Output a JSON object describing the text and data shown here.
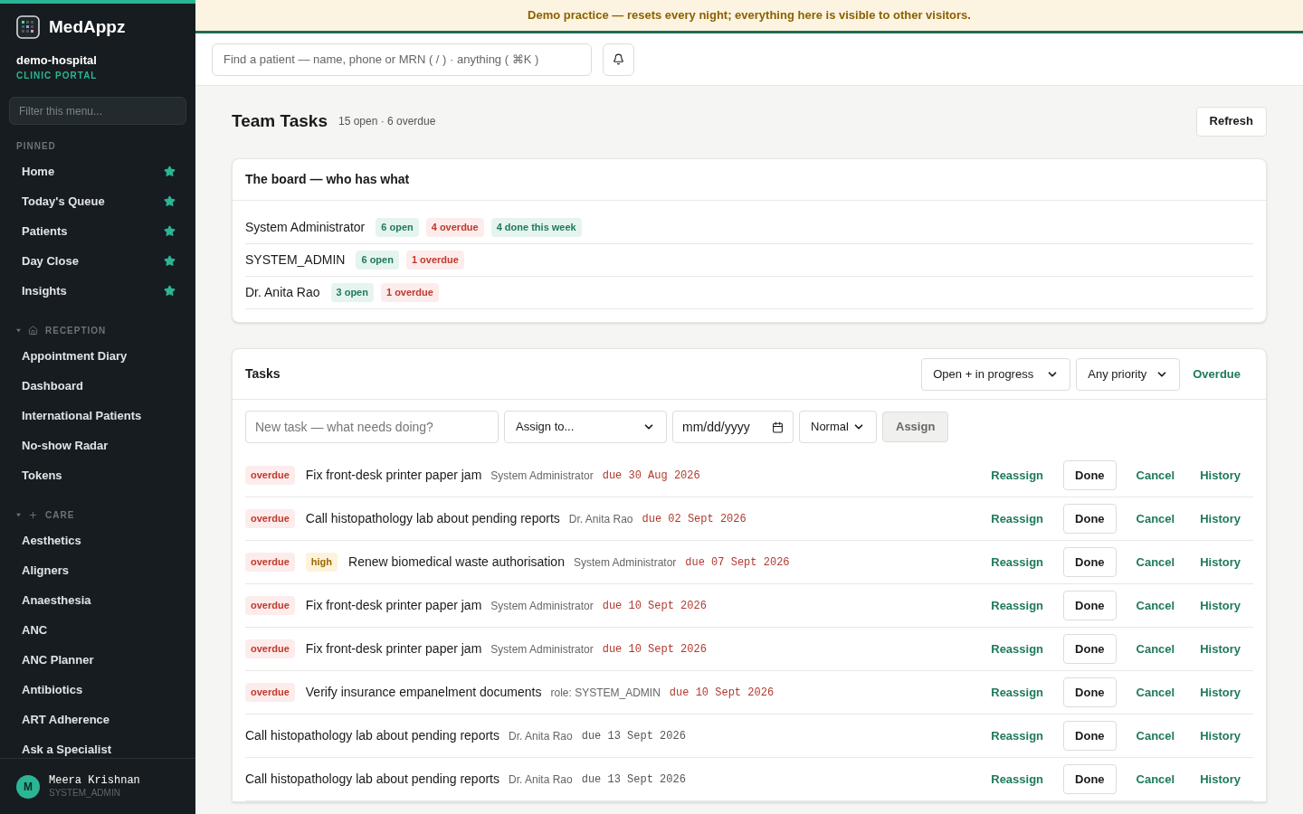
{
  "banner": "Demo practice — resets every night; everything here is visible to other visitors.",
  "brand": {
    "name": "MedAppz",
    "org": "demo-hospital",
    "portal": "CLINIC PORTAL"
  },
  "sidebar": {
    "filter_placeholder": "Filter this menu...",
    "pinned": {
      "title": "PINNED",
      "items": [
        {
          "label": "Home",
          "starred": true
        },
        {
          "label": "Today's Queue",
          "starred": true
        },
        {
          "label": "Patients",
          "starred": true
        },
        {
          "label": "Day Close",
          "starred": true
        },
        {
          "label": "Insights",
          "starred": true
        }
      ]
    },
    "sections": [
      {
        "title": "RECEPTION",
        "kind": "home",
        "expanded": true,
        "items": [
          "Appointment Diary",
          "Dashboard",
          "International Patients",
          "No-show Radar",
          "Tokens"
        ]
      },
      {
        "title": "CARE",
        "kind": "plus",
        "expanded": true,
        "items": [
          "Aesthetics",
          "Aligners",
          "Anaesthesia",
          "ANC",
          "ANC Planner",
          "Antibiotics",
          "ART Adherence",
          "Ask a Specialist"
        ]
      }
    ],
    "user": {
      "initial": "M",
      "name": "Meera Krishnan",
      "role": "SYSTEM_ADMIN"
    }
  },
  "search": {
    "placeholder": "Find a patient — name, phone or MRN ( / ) · anything ( ⌘K )"
  },
  "page": {
    "title": "Team Tasks",
    "summary": "15 open · 6 overdue",
    "refresh": "Refresh"
  },
  "board": {
    "title": "The board — who has what",
    "rows": [
      {
        "name": "System Administrator",
        "chips": [
          {
            "label": "6 open",
            "kind": "open"
          },
          {
            "label": "4 overdue",
            "kind": "overdue"
          },
          {
            "label": "4 done this week",
            "kind": "done"
          }
        ]
      },
      {
        "name": "SYSTEM_ADMIN",
        "chips": [
          {
            "label": "6 open",
            "kind": "open"
          },
          {
            "label": "1 overdue",
            "kind": "overdue"
          }
        ]
      },
      {
        "name": "Dr. Anita Rao",
        "chips": [
          {
            "label": "3 open",
            "kind": "open"
          },
          {
            "label": "1 overdue",
            "kind": "overdue"
          }
        ]
      }
    ]
  },
  "tasks": {
    "title": "Tasks",
    "status_filter": "Open + in progress",
    "priority_filter": "Any priority",
    "overdue_link": "Overdue",
    "new_task": {
      "placeholder": "New task — what needs doing?",
      "assign_to": "Assign to...",
      "date": "mm/dd/yyyy",
      "priority": "Normal",
      "submit": "Assign"
    },
    "rows": [
      {
        "overdue": true,
        "badges": [
          {
            "label": "overdue",
            "kind": "overdue"
          }
        ],
        "title": "Fix front-desk printer paper jam",
        "assignee": "System Administrator",
        "due": "due 30 Aug 2026",
        "actions": [
          "Reassign",
          "Done",
          "Cancel",
          "History"
        ]
      },
      {
        "overdue": true,
        "badges": [
          {
            "label": "overdue",
            "kind": "overdue"
          }
        ],
        "title": "Call histopathology lab about pending reports",
        "assignee": "Dr. Anita Rao",
        "due": "due 02 Sept 2026",
        "actions": [
          "Reassign",
          "Done",
          "Cancel",
          "History"
        ]
      },
      {
        "overdue": true,
        "badges": [
          {
            "label": "overdue",
            "kind": "overdue"
          },
          {
            "label": "high",
            "kind": "priority"
          }
        ],
        "title": "Renew biomedical waste authorisation",
        "assignee": "System Administrator",
        "due": "due 07 Sept 2026",
        "actions": [
          "Reassign",
          "Done",
          "Cancel",
          "History"
        ]
      },
      {
        "overdue": true,
        "badges": [
          {
            "label": "overdue",
            "kind": "overdue"
          }
        ],
        "title": "Fix front-desk printer paper jam",
        "assignee": "System Administrator",
        "due": "due 10 Sept 2026",
        "actions": [
          "Reassign",
          "Done",
          "Cancel",
          "History"
        ]
      },
      {
        "overdue": true,
        "badges": [
          {
            "label": "overdue",
            "kind": "overdue"
          }
        ],
        "title": "Fix front-desk printer paper jam",
        "assignee": "System Administrator",
        "due": "due 10 Sept 2026",
        "actions": [
          "Reassign",
          "Done",
          "Cancel",
          "History"
        ]
      },
      {
        "overdue": true,
        "badges": [
          {
            "label": "overdue",
            "kind": "overdue"
          }
        ],
        "title": "Verify insurance empanelment documents",
        "assignee": "role: SYSTEM_ADMIN",
        "due": "due 10 Sept 2026",
        "actions": [
          "Reassign",
          "Done",
          "Cancel",
          "History"
        ]
      },
      {
        "overdue": false,
        "badges": [],
        "title": "Call histopathology lab about pending reports",
        "assignee": "Dr. Anita Rao",
        "due": "due 13 Sept 2026",
        "actions": [
          "Reassign",
          "Done",
          "Cancel",
          "History"
        ]
      },
      {
        "overdue": false,
        "badges": [],
        "title": "Call histopathology lab about pending reports",
        "assignee": "Dr. Anita Rao",
        "due": "due 13 Sept 2026",
        "actions": [
          "Reassign",
          "Done",
          "Cancel",
          "History"
        ]
      }
    ]
  }
}
